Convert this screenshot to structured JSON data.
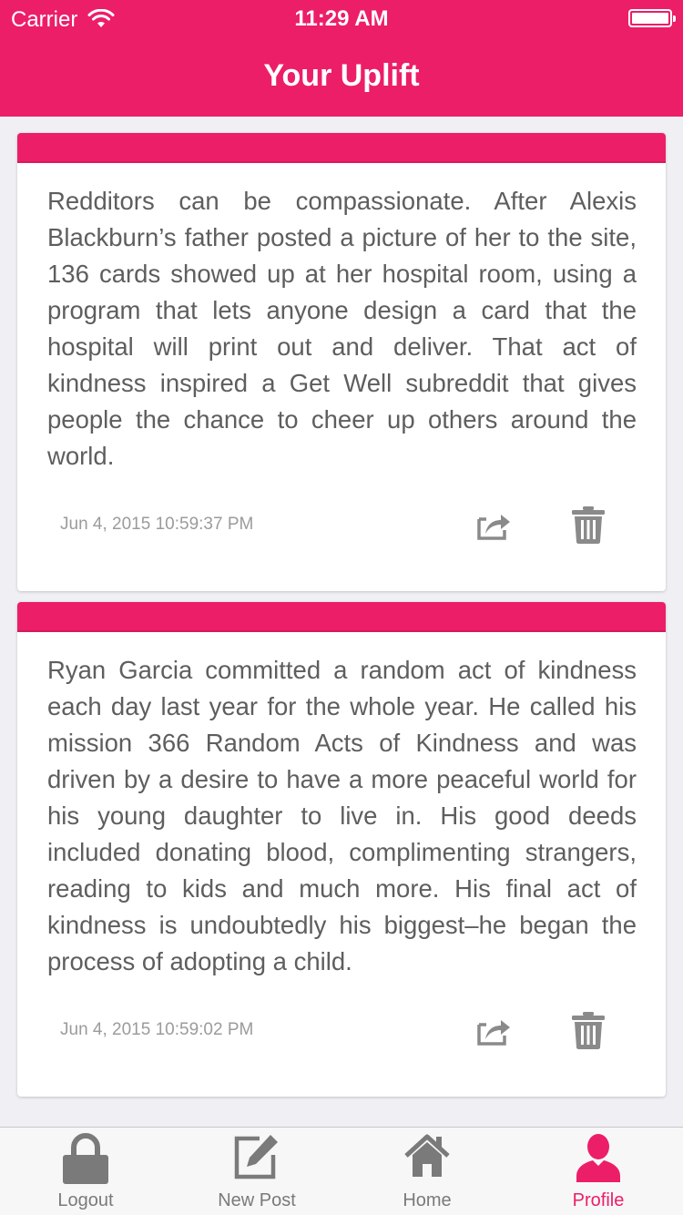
{
  "status_bar": {
    "carrier": "Carrier",
    "time": "11:29 AM"
  },
  "nav": {
    "title": "Your Uplift"
  },
  "colors": {
    "accent": "#ec1e67",
    "icon_gray": "#8a8a8a",
    "text": "#5e5e5e",
    "timestamp": "#9b9b9b"
  },
  "posts": [
    {
      "text": "Redditors can be compassionate. After Alexis Blackburn’s father posted a picture of her to the site, 136 cards showed up at her hospital room, using a program that lets anyone design a card that the hospital will print out and deliver. That act of kindness inspired a Get Well subreddit that gives people the chance to cheer up others around the world.",
      "timestamp": "Jun 4, 2015 10:59:37 PM",
      "share_icon": "share-icon",
      "delete_icon": "trash-icon"
    },
    {
      "text": "Ryan Garcia committed a random act of kindness each day last year for the whole year. He called his mission 366 Random Acts of Kindness and was driven by a desire to have a more peaceful world for his young daughter to live in. His good deeds included donating blood, complimenting strangers, reading to kids and much more. His final act of kindness is undoubtedly his biggest–he began the process of adopting a child.",
      "timestamp": "Jun 4, 2015 10:59:02 PM",
      "share_icon": "share-icon",
      "delete_icon": "trash-icon"
    }
  ],
  "tab_bar": {
    "tabs": [
      {
        "label": "Logout",
        "icon": "lock-icon",
        "active": false
      },
      {
        "label": "New Post",
        "icon": "compose-icon",
        "active": false
      },
      {
        "label": "Home",
        "icon": "home-icon",
        "active": false
      },
      {
        "label": "Profile",
        "icon": "person-icon",
        "active": true
      }
    ]
  }
}
